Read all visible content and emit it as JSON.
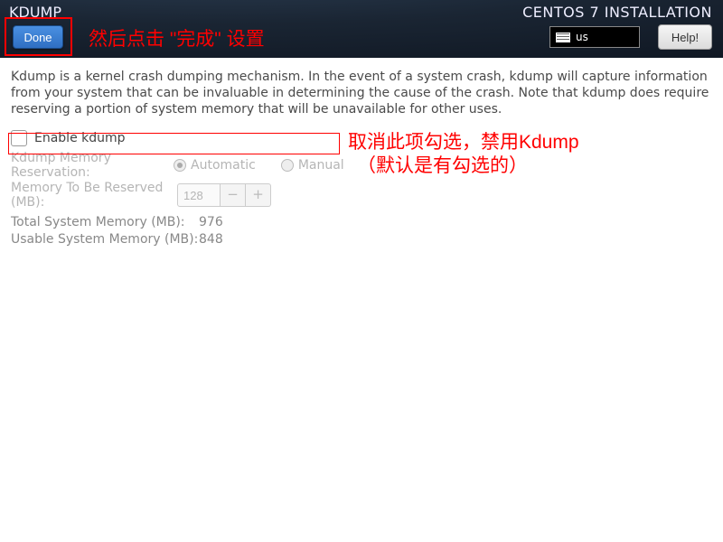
{
  "header": {
    "title_left": "KDUMP",
    "title_right": "CENTOS 7 INSTALLATION",
    "done_label": "Done",
    "help_label": "Help!",
    "keyboard_layout": "us"
  },
  "annotations": {
    "done_note": "然后点击 \"完成\" 设置",
    "disable_line1": "取消此项勾选，禁用Kdump",
    "disable_line2": "（默认是有勾选的）"
  },
  "intro": "Kdump is a kernel crash dumping mechanism. In the event of a system crash, kdump will capture information from your system that can be invaluable in determining the cause of the crash. Note that kdump does require reserving a portion of system memory that will be unavailable for other uses.",
  "enable": {
    "label": "Enable kdump",
    "checked": false
  },
  "reservation": {
    "label": "Kdump Memory Reservation:",
    "automatic_label": "Automatic",
    "manual_label": "Manual",
    "mode": "Automatic"
  },
  "memory_to_reserve": {
    "label": "Memory To Be Reserved (MB):",
    "value": "128"
  },
  "total_memory": {
    "label": "Total System Memory (MB):",
    "value": "976"
  },
  "usable_memory": {
    "label": "Usable System Memory (MB):",
    "value": "848"
  }
}
